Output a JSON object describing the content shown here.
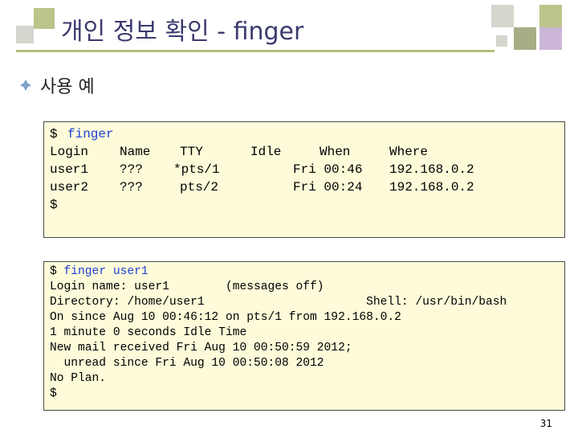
{
  "slide": {
    "title": "개인 정보 확인 - finger",
    "bullet": "사용 예",
    "page_number": "31",
    "colors": {
      "square_green": "#bcc48b",
      "square_gray": "#d4d7cd",
      "square_dark_green": "#a9ad86",
      "square_lavender": "#ccb6d8",
      "title_rule": "#b5bd7a",
      "terminal_bg": "#fdfbd9",
      "bullet_icon": "#7aa0c7"
    }
  },
  "terminal1": {
    "prompt": "$",
    "command": "finger",
    "header": {
      "login": "Login",
      "name": "Name",
      "tty": "TTY",
      "idle": "Idle",
      "when": "When",
      "where": "Where"
    },
    "rows": [
      {
        "login": "user1",
        "name": "???",
        "tty": "*pts/1",
        "idle": "",
        "when": "Fri 00:46",
        "where": "192.168.0.2"
      },
      {
        "login": "user2",
        "name": "???",
        "tty": "pts/2",
        "idle": "",
        "when": "Fri 00:24",
        "where": "192.168.0.2"
      }
    ],
    "final_prompt": "$"
  },
  "terminal2": {
    "prompt": "$",
    "command": "finger user1",
    "lines": [
      "Login name: user1        (messages off)",
      "Directory: /home/user1                       Shell: /usr/bin/bash",
      "On since Aug 10 00:46:12 on pts/1 from 192.168.0.2",
      "1 minute 0 seconds Idle Time",
      "New mail received Fri Aug 10 00:50:59 2012;",
      "  unread since Fri Aug 10 00:50:08 2012",
      "No Plan.",
      "$"
    ]
  }
}
